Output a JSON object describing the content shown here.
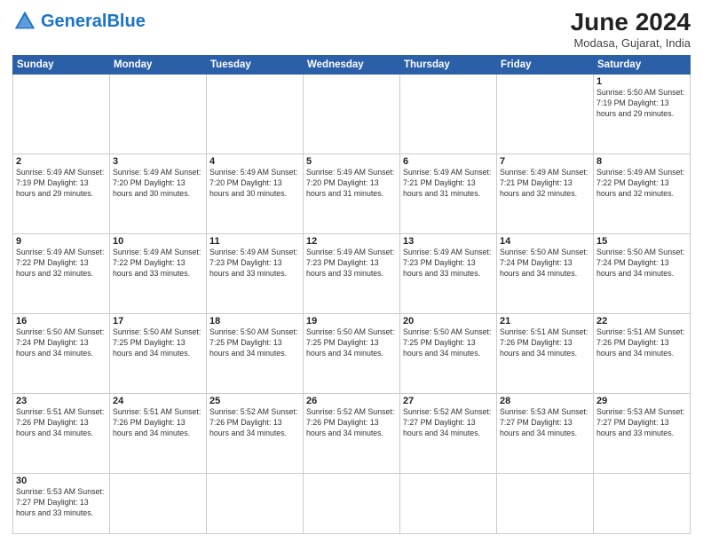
{
  "header": {
    "logo_general": "General",
    "logo_blue": "Blue",
    "month": "June 2024",
    "location": "Modasa, Gujarat, India"
  },
  "days_of_week": [
    "Sunday",
    "Monday",
    "Tuesday",
    "Wednesday",
    "Thursday",
    "Friday",
    "Saturday"
  ],
  "weeks": [
    [
      {
        "day": "",
        "info": "",
        "empty": true
      },
      {
        "day": "",
        "info": "",
        "empty": true
      },
      {
        "day": "",
        "info": "",
        "empty": true
      },
      {
        "day": "",
        "info": "",
        "empty": true
      },
      {
        "day": "",
        "info": "",
        "empty": true
      },
      {
        "day": "",
        "info": "",
        "empty": true
      },
      {
        "day": "1",
        "info": "Sunrise: 5:50 AM\nSunset: 7:19 PM\nDaylight: 13 hours and 29 minutes."
      }
    ],
    [
      {
        "day": "2",
        "info": "Sunrise: 5:49 AM\nSunset: 7:19 PM\nDaylight: 13 hours and 29 minutes."
      },
      {
        "day": "3",
        "info": "Sunrise: 5:49 AM\nSunset: 7:20 PM\nDaylight: 13 hours and 30 minutes."
      },
      {
        "day": "4",
        "info": "Sunrise: 5:49 AM\nSunset: 7:20 PM\nDaylight: 13 hours and 30 minutes."
      },
      {
        "day": "5",
        "info": "Sunrise: 5:49 AM\nSunset: 7:20 PM\nDaylight: 13 hours and 31 minutes."
      },
      {
        "day": "6",
        "info": "Sunrise: 5:49 AM\nSunset: 7:21 PM\nDaylight: 13 hours and 31 minutes."
      },
      {
        "day": "7",
        "info": "Sunrise: 5:49 AM\nSunset: 7:21 PM\nDaylight: 13 hours and 32 minutes."
      },
      {
        "day": "8",
        "info": "Sunrise: 5:49 AM\nSunset: 7:22 PM\nDaylight: 13 hours and 32 minutes."
      }
    ],
    [
      {
        "day": "9",
        "info": "Sunrise: 5:49 AM\nSunset: 7:22 PM\nDaylight: 13 hours and 32 minutes."
      },
      {
        "day": "10",
        "info": "Sunrise: 5:49 AM\nSunset: 7:22 PM\nDaylight: 13 hours and 33 minutes."
      },
      {
        "day": "11",
        "info": "Sunrise: 5:49 AM\nSunset: 7:23 PM\nDaylight: 13 hours and 33 minutes."
      },
      {
        "day": "12",
        "info": "Sunrise: 5:49 AM\nSunset: 7:23 PM\nDaylight: 13 hours and 33 minutes."
      },
      {
        "day": "13",
        "info": "Sunrise: 5:49 AM\nSunset: 7:23 PM\nDaylight: 13 hours and 33 minutes."
      },
      {
        "day": "14",
        "info": "Sunrise: 5:50 AM\nSunset: 7:24 PM\nDaylight: 13 hours and 34 minutes."
      },
      {
        "day": "15",
        "info": "Sunrise: 5:50 AM\nSunset: 7:24 PM\nDaylight: 13 hours and 34 minutes."
      }
    ],
    [
      {
        "day": "16",
        "info": "Sunrise: 5:50 AM\nSunset: 7:24 PM\nDaylight: 13 hours and 34 minutes."
      },
      {
        "day": "17",
        "info": "Sunrise: 5:50 AM\nSunset: 7:25 PM\nDaylight: 13 hours and 34 minutes."
      },
      {
        "day": "18",
        "info": "Sunrise: 5:50 AM\nSunset: 7:25 PM\nDaylight: 13 hours and 34 minutes."
      },
      {
        "day": "19",
        "info": "Sunrise: 5:50 AM\nSunset: 7:25 PM\nDaylight: 13 hours and 34 minutes."
      },
      {
        "day": "20",
        "info": "Sunrise: 5:50 AM\nSunset: 7:25 PM\nDaylight: 13 hours and 34 minutes."
      },
      {
        "day": "21",
        "info": "Sunrise: 5:51 AM\nSunset: 7:26 PM\nDaylight: 13 hours and 34 minutes."
      },
      {
        "day": "22",
        "info": "Sunrise: 5:51 AM\nSunset: 7:26 PM\nDaylight: 13 hours and 34 minutes."
      }
    ],
    [
      {
        "day": "23",
        "info": "Sunrise: 5:51 AM\nSunset: 7:26 PM\nDaylight: 13 hours and 34 minutes."
      },
      {
        "day": "24",
        "info": "Sunrise: 5:51 AM\nSunset: 7:26 PM\nDaylight: 13 hours and 34 minutes."
      },
      {
        "day": "25",
        "info": "Sunrise: 5:52 AM\nSunset: 7:26 PM\nDaylight: 13 hours and 34 minutes."
      },
      {
        "day": "26",
        "info": "Sunrise: 5:52 AM\nSunset: 7:26 PM\nDaylight: 13 hours and 34 minutes."
      },
      {
        "day": "27",
        "info": "Sunrise: 5:52 AM\nSunset: 7:27 PM\nDaylight: 13 hours and 34 minutes."
      },
      {
        "day": "28",
        "info": "Sunrise: 5:53 AM\nSunset: 7:27 PM\nDaylight: 13 hours and 34 minutes."
      },
      {
        "day": "29",
        "info": "Sunrise: 5:53 AM\nSunset: 7:27 PM\nDaylight: 13 hours and 33 minutes."
      }
    ],
    [
      {
        "day": "30",
        "info": "Sunrise: 5:53 AM\nSunset: 7:27 PM\nDaylight: 13 hours and 33 minutes."
      },
      {
        "day": "",
        "info": "",
        "empty": true
      },
      {
        "day": "",
        "info": "",
        "empty": true
      },
      {
        "day": "",
        "info": "",
        "empty": true
      },
      {
        "day": "",
        "info": "",
        "empty": true
      },
      {
        "day": "",
        "info": "",
        "empty": true
      },
      {
        "day": "",
        "info": "",
        "empty": true
      }
    ]
  ]
}
